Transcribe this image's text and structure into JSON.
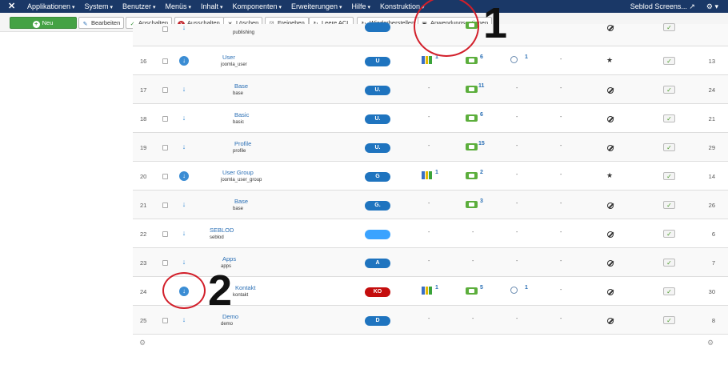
{
  "topbar": {
    "logo": "✕",
    "menu": [
      "Applikationen",
      "System",
      "Benutzer",
      "Menüs",
      "Inhalt",
      "Komponenten",
      "Erweiterungen",
      "Hilfe",
      "Konstruktion"
    ],
    "site": "Seblod Screens...",
    "site_icon": "external-link-icon",
    "settings_icon": "gear-icon"
  },
  "toolbar": {
    "new": "Neu",
    "edit": "Bearbeiten",
    "publish": "Anschalten",
    "unpublish": "Ausschalten",
    "delete": "Löschen",
    "approve": "Freigeben",
    "empty_acl": "Leere ACL",
    "restore": "Wiederherstellen",
    "options": "Anwendungsoptionen"
  },
  "rows": [
    {
      "num": "",
      "title": "",
      "sub": "publishing",
      "badge": "",
      "rightnum": ""
    },
    {
      "num": "16",
      "title": "User",
      "sub": "joomla_user",
      "badge": "U",
      "tab": "1",
      "cnt": "6",
      "srch": "1",
      "mark": "★",
      "rightnum": "13"
    },
    {
      "num": "17",
      "title": "Base",
      "sub": "base",
      "badge": "U.",
      "cnt": "11",
      "rightnum": "24"
    },
    {
      "num": "18",
      "title": "Basic",
      "sub": "basic",
      "badge": "U.",
      "cnt": "6",
      "rightnum": "21"
    },
    {
      "num": "19",
      "title": "Profile",
      "sub": "profile",
      "badge": "U.",
      "cnt": "15",
      "rightnum": "29"
    },
    {
      "num": "20",
      "title": "User Group",
      "sub": "joomla_user_group",
      "badge": "G",
      "tab": "1",
      "cnt": "2",
      "mark": "★",
      "rightnum": "14"
    },
    {
      "num": "21",
      "title": "Base",
      "sub": "base",
      "badge": "G.",
      "cnt": "3",
      "rightnum": "26"
    },
    {
      "num": "22",
      "title": "SEBLOD",
      "sub": "seblod",
      "badge": "",
      "rightnum": "6"
    },
    {
      "num": "23",
      "title": "Apps",
      "sub": "apps",
      "badge": "A",
      "rightnum": "7"
    },
    {
      "num": "24",
      "title": "Kontakt",
      "sub": "kontakt",
      "badge": "KO",
      "tab": "1",
      "cnt": "5",
      "srch": "1",
      "rightnum": "30"
    },
    {
      "num": "25",
      "title": "Demo",
      "sub": "demo",
      "badge": "D",
      "rightnum": "8"
    }
  ],
  "dash": "-",
  "annotations": {
    "one": "1",
    "two": "2"
  },
  "footer_icon": "gear-icon",
  "colors": {
    "navbar": "#1a3867",
    "badge_blue": "#1f74bf",
    "badge_red": "#c40d0d",
    "annotation_red": "#d21f2a",
    "new_green": "#45a245"
  }
}
